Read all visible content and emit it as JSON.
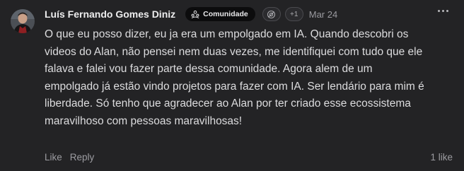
{
  "post": {
    "author": "Luís Fernando Gomes Diniz",
    "badge_label": "Comunidade",
    "badge_icon": "community-icon",
    "plus_count": "+1",
    "date": "Mar 24",
    "body": "O que eu posso dizer, eu ja era um empolgado em IA. Quando descobri os videos do Alan, não pensei nem duas vezes, me identifiquei com tudo que ele falava e falei vou fazer parte dessa comunidade. Agora alem de um empolgado já estão vindo projetos para fazer com IA. Ser lendário para mim é liberdade. Só tenho que agradecer ao Alan por ter criado esse ecossistema maravilhoso com pessoas maravilhosas!",
    "actions": {
      "like": "Like",
      "reply": "Reply"
    },
    "likes_count": "1 like"
  },
  "colors": {
    "background": "#232325",
    "text": "#dcdcde",
    "muted": "#9c9ca1",
    "badge_bg": "#0c0c0d"
  }
}
